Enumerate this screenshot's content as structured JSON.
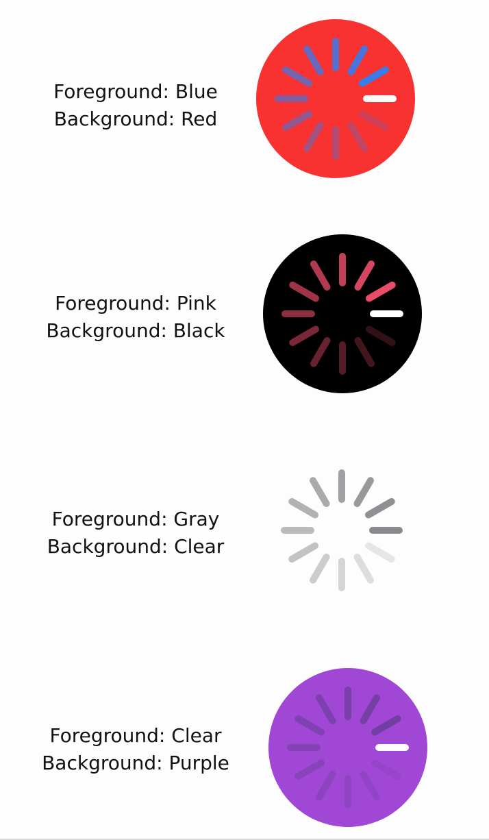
{
  "spinners": [
    {
      "foreground_label": "Foreground: Blue",
      "background_label": "Background: Red",
      "foreground_color": "#2f7ff2",
      "background_color": "#f83131",
      "lead_tick_color": "#ffffff"
    },
    {
      "foreground_label": "Foreground: Pink",
      "background_label": "Background: Black",
      "foreground_color": "#f4506f",
      "background_color": "#000000",
      "lead_tick_color": "#ffffff"
    },
    {
      "foreground_label": "Foreground: Gray",
      "background_label": "Background: Clear",
      "foreground_color": "#8a8a8e",
      "background_color": "transparent",
      "lead_tick_color": "#8a8a8e"
    },
    {
      "foreground_label": "Foreground: Clear",
      "background_label": "Background: Purple",
      "foreground_color": "#6f3f9e",
      "background_color": "#a047d6",
      "lead_tick_color": "#ffffff"
    }
  ]
}
